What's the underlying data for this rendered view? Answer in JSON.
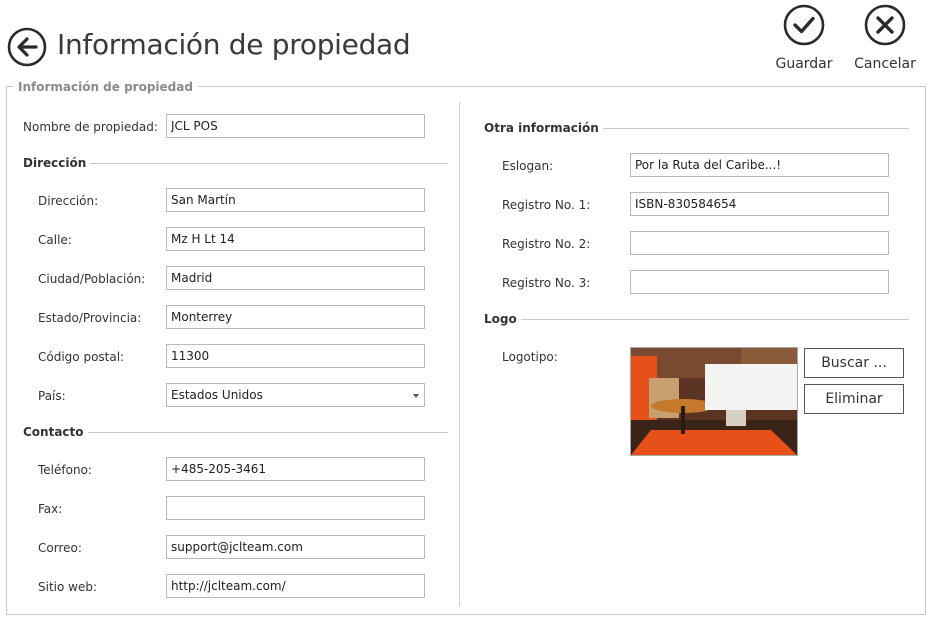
{
  "header": {
    "title": "Información de propiedad",
    "save_label": "Guardar",
    "cancel_label": "Cancelar"
  },
  "group": {
    "legend": "Información de propiedad"
  },
  "left": {
    "property_name": {
      "label": "Nombre de propiedad:",
      "value": "JCL POS"
    },
    "address_section": "Dirección",
    "address": {
      "label": "Dirección:",
      "value": "San Martín"
    },
    "street": {
      "label": "Calle:",
      "value": "Mz H Lt 14"
    },
    "city": {
      "label": "Ciudad/Población:",
      "value": "Madrid"
    },
    "state": {
      "label": "Estado/Provincia:",
      "value": "Monterrey"
    },
    "postal": {
      "label": "Código postal:",
      "value": "11300"
    },
    "country": {
      "label": "País:",
      "value": "Estados Unidos"
    },
    "contact_section": "Contacto",
    "phone": {
      "label": "Teléfono:",
      "value": "+485-205-3461"
    },
    "fax": {
      "label": "Fax:",
      "value": ""
    },
    "email": {
      "label": "Correo:",
      "value": "support@jclteam.com"
    },
    "website": {
      "label": "Sitio web:",
      "value": "http://jclteam.com/"
    }
  },
  "right": {
    "other_section": "Otra información",
    "slogan": {
      "label": "Eslogan:",
      "value": "Por la Ruta del Caribe...!"
    },
    "reg1": {
      "label": "Registro No. 1:",
      "value": "ISBN-830584654"
    },
    "reg2": {
      "label": "Registro No. 2:",
      "value": ""
    },
    "reg3": {
      "label": "Registro No. 3:",
      "value": ""
    },
    "logo_section": "Logo",
    "logo_label": "Logotipo:",
    "browse_label": "Buscar ...",
    "remove_label": "Eliminar"
  },
  "colors": {
    "accent_orange": "#e8501a",
    "border": "#b9b9b9",
    "text": "#333333"
  },
  "icons": {
    "back": "back-arrow-icon",
    "save": "check-circle-icon",
    "cancel": "close-circle-icon"
  }
}
